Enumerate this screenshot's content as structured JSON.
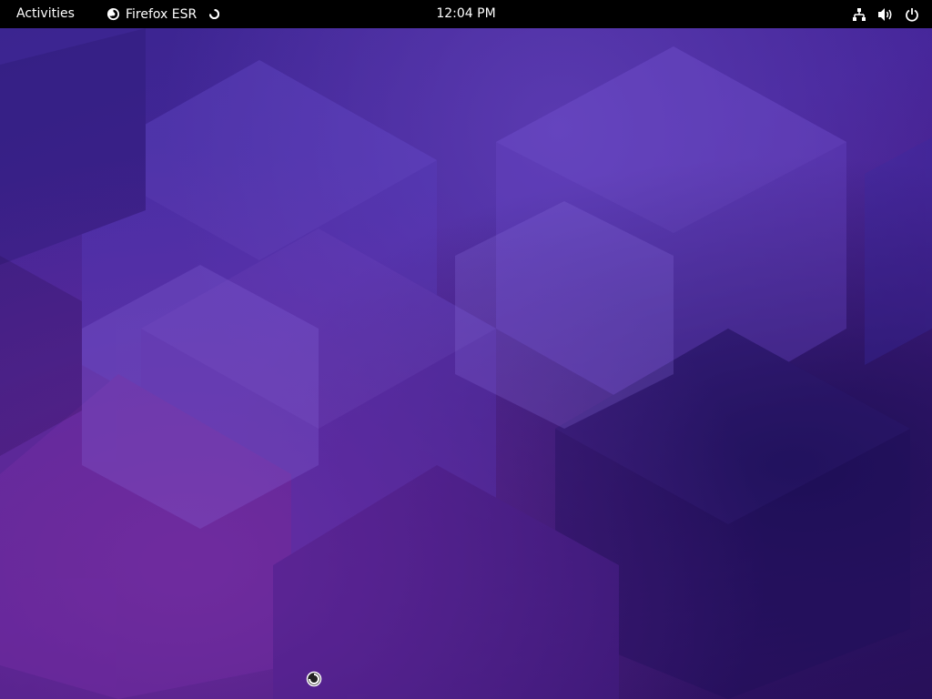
{
  "topbar": {
    "activities_label": "Activities",
    "app_name": "Firefox ESR",
    "clock": "12:04 PM",
    "icons": [
      "firefox-icon",
      "loading-spinner-icon",
      "network-icon",
      "volume-icon",
      "power-icon"
    ]
  },
  "colors": {
    "topbar_bg": "#000000",
    "text": "#ffffff",
    "wallpaper_base": "#3a1f86",
    "wallpaper_accent": "#6a2a9a"
  }
}
